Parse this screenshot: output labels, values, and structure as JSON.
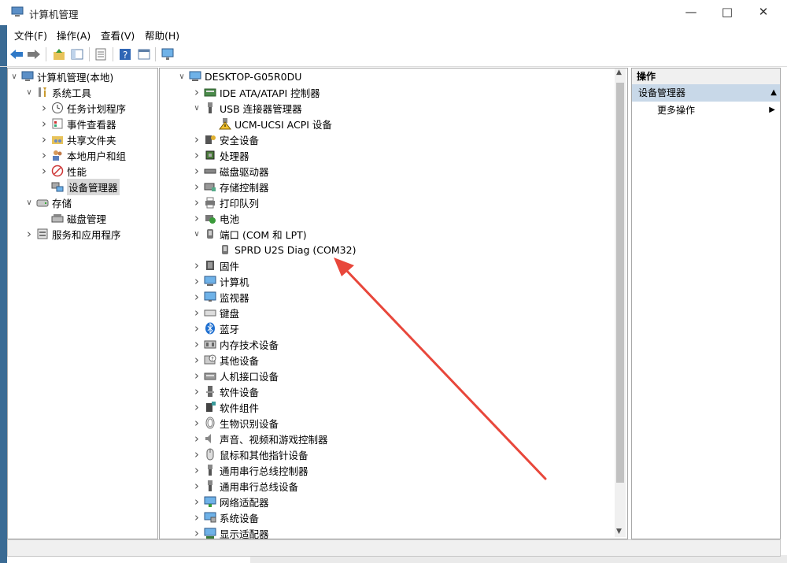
{
  "window": {
    "title": "计算机管理",
    "menu": [
      "文件(F)",
      "操作(A)",
      "查看(V)",
      "帮助(H)"
    ]
  },
  "left_tree": [
    {
      "label": "计算机管理(本地)",
      "icon": "computer-management-icon",
      "expand": "open"
    },
    {
      "label": "系统工具",
      "icon": "tools-icon",
      "expand": "open"
    },
    {
      "label": "任务计划程序",
      "icon": "clock-icon",
      "expand": "closed"
    },
    {
      "label": "事件查看器",
      "icon": "event-viewer-icon",
      "expand": "closed"
    },
    {
      "label": "共享文件夹",
      "icon": "shared-folder-icon",
      "expand": "closed"
    },
    {
      "label": "本地用户和组",
      "icon": "users-icon",
      "expand": "closed"
    },
    {
      "label": "性能",
      "icon": "performance-icon",
      "expand": "closed"
    },
    {
      "label": "设备管理器",
      "icon": "device-manager-icon",
      "expand": "none",
      "selected": true
    },
    {
      "label": "存储",
      "icon": "storage-icon",
      "expand": "open"
    },
    {
      "label": "磁盘管理",
      "icon": "disk-management-icon",
      "expand": "none"
    },
    {
      "label": "服务和应用程序",
      "icon": "services-icon",
      "expand": "closed"
    }
  ],
  "device_tree": [
    {
      "label": "DESKTOP-G05R0DU",
      "icon": "computer-icon",
      "expand": "open"
    },
    {
      "label": "IDE ATA/ATAPI 控制器",
      "icon": "ide-icon",
      "expand": "closed"
    },
    {
      "label": "USB 连接器管理器",
      "icon": "usb-icon",
      "expand": "open"
    },
    {
      "label": "UCM-UCSI ACPI 设备",
      "icon": "warning-icon",
      "expand": "none"
    },
    {
      "label": "安全设备",
      "icon": "security-device-icon",
      "expand": "closed"
    },
    {
      "label": "处理器",
      "icon": "processor-icon",
      "expand": "closed"
    },
    {
      "label": "磁盘驱动器",
      "icon": "disk-drive-icon",
      "expand": "closed"
    },
    {
      "label": "存储控制器",
      "icon": "storage-controller-icon",
      "expand": "closed"
    },
    {
      "label": "打印队列",
      "icon": "printer-icon",
      "expand": "closed"
    },
    {
      "label": "电池",
      "icon": "battery-icon",
      "expand": "closed"
    },
    {
      "label": "端口 (COM 和 LPT)",
      "icon": "port-icon",
      "expand": "open"
    },
    {
      "label": "SPRD U2S Diag (COM32)",
      "icon": "port-icon",
      "expand": "none"
    },
    {
      "label": "固件",
      "icon": "firmware-icon",
      "expand": "closed"
    },
    {
      "label": "计算机",
      "icon": "computer-icon",
      "expand": "closed"
    },
    {
      "label": "监视器",
      "icon": "monitor-icon",
      "expand": "closed"
    },
    {
      "label": "键盘",
      "icon": "keyboard-icon",
      "expand": "closed"
    },
    {
      "label": "蓝牙",
      "icon": "bluetooth-icon",
      "expand": "closed"
    },
    {
      "label": "内存技术设备",
      "icon": "memory-icon",
      "expand": "closed"
    },
    {
      "label": "其他设备",
      "icon": "unknown-device-icon",
      "expand": "closed"
    },
    {
      "label": "人机接口设备",
      "icon": "hid-icon",
      "expand": "closed"
    },
    {
      "label": "软件设备",
      "icon": "software-device-icon",
      "expand": "closed"
    },
    {
      "label": "软件组件",
      "icon": "software-component-icon",
      "expand": "closed"
    },
    {
      "label": "生物识别设备",
      "icon": "fingerprint-icon",
      "expand": "closed"
    },
    {
      "label": "声音、视频和游戏控制器",
      "icon": "sound-icon",
      "expand": "closed"
    },
    {
      "label": "鼠标和其他指针设备",
      "icon": "mouse-icon",
      "expand": "closed"
    },
    {
      "label": "通用串行总线控制器",
      "icon": "usb-icon",
      "expand": "closed"
    },
    {
      "label": "通用串行总线设备",
      "icon": "usb-icon",
      "expand": "closed"
    },
    {
      "label": "网络适配器",
      "icon": "network-icon",
      "expand": "closed"
    },
    {
      "label": "系统设备",
      "icon": "system-device-icon",
      "expand": "closed"
    },
    {
      "label": "显示适配器",
      "icon": "display-adapter-icon",
      "expand": "closed"
    }
  ],
  "actions": {
    "header": "操作",
    "section": "设备管理器",
    "more": "更多操作"
  },
  "colors": {
    "annotation_arrow": "#e8473b",
    "selection": "#d9d9d9",
    "action_selected": "#c8d8e8"
  }
}
